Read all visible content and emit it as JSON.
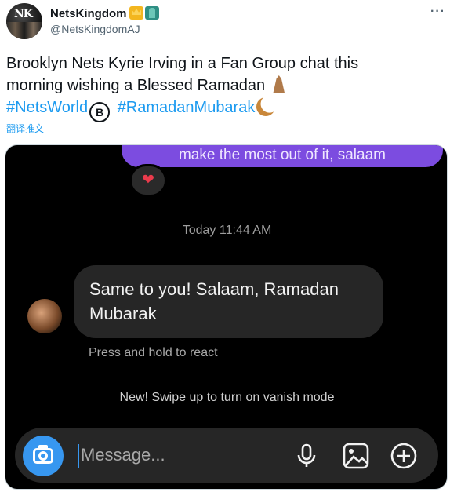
{
  "tweet": {
    "display_name": "NetsKingdom",
    "handle": "@NetsKingdomAJ",
    "avatar_text": "NK",
    "text_line1": "Brooklyn Nets Kyrie Irving in a Fan Group chat this",
    "text_line2": "morning wishing a Blessed Ramadan",
    "hashtag1": "#NetsWorld",
    "hashtag2": "#RamadanMubarak",
    "translate_label": "翻译推文",
    "more_label": "···"
  },
  "chat": {
    "sent_message_fragment": "make the most out of it, salaam",
    "timestamp": "Today 11:44 AM",
    "received_message": "Same to you! Salaam, Ramadan Mubarak",
    "react_hint": "Press and hold to react",
    "vanish_hint": "New! Swipe up to turn on vanish mode",
    "composer_placeholder": "Message...",
    "reaction_icon": "heart-icon"
  },
  "colors": {
    "twitter_blue": "#1d9bf0",
    "sent_bubble": "#7c4ce0",
    "camera_button": "#3797f0"
  }
}
